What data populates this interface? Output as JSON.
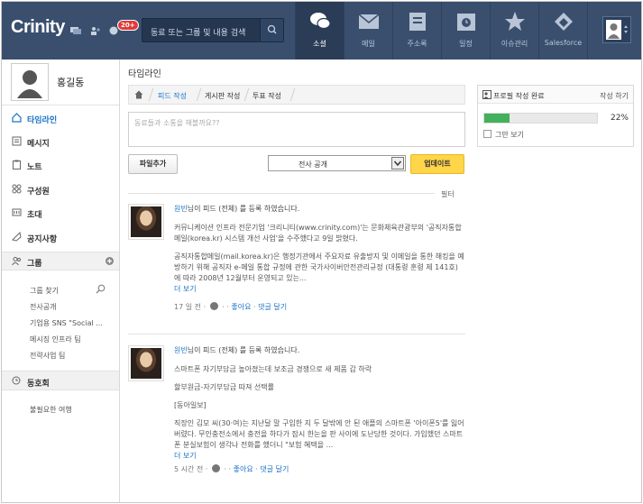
{
  "app": {
    "logo": "Crinity",
    "notification_badge": "20+"
  },
  "search": {
    "placeholder": "동료 또는 그룹 및 내용 검색"
  },
  "nav": [
    {
      "label": "소셜",
      "icon": "chat-bubbles-icon",
      "active": true
    },
    {
      "label": "메일",
      "icon": "mail-icon",
      "active": false
    },
    {
      "label": "주소록",
      "icon": "address-book-icon",
      "active": false
    },
    {
      "label": "일정",
      "icon": "calendar-icon",
      "active": false
    },
    {
      "label": "이슈관리",
      "icon": "star-icon",
      "active": false
    },
    {
      "label": "Salesforce",
      "icon": "salesforce-icon",
      "active": false
    }
  ],
  "profile": {
    "name": "홍길동"
  },
  "sidebar": {
    "items": [
      {
        "label": "타임라인",
        "icon": "home-icon"
      },
      {
        "label": "메시지",
        "icon": "message-icon"
      },
      {
        "label": "노트",
        "icon": "note-icon"
      },
      {
        "label": "구성원",
        "icon": "members-icon"
      },
      {
        "label": "초대",
        "icon": "invite-icon"
      },
      {
        "label": "공지사항",
        "icon": "notice-icon"
      }
    ],
    "group": {
      "label": "그룹",
      "find": "그룹 찾기",
      "subs": [
        "전사공개",
        "기업용 SNS \"Social ...",
        "메시징 인프라 팀",
        "전략사업 팀"
      ]
    },
    "club": {
      "label": "동호회",
      "subs": [
        "불필요한 여행"
      ]
    }
  },
  "main": {
    "title": "타임라인",
    "tabs": [
      "피드 작성",
      "게시판 작성",
      "투표 작성"
    ],
    "compose_placeholder": "동료들과 소통을 해볼까요??",
    "file_button": "파일추가",
    "visibility": "전사 공개",
    "update_button": "업데이트",
    "filter": "필터"
  },
  "posts": [
    {
      "author": "원빈",
      "action": "님이 피드 (전체) 를 등록 하였습니다.",
      "paragraphs": [
        "커뮤니케이션 인프라 전문기업 '크리니티(www.crinity.com)'는 문화체육관광부의 '공직자통합메일(korea.kr) 시스템 개선 사업'을 수주했다고 9일 밝혔다.",
        "공직자통합메일(mail.korea.kr)은 행정기관에서 주요자료 유출방지 및 이메일을 통한 해킹을 예방하기 위해 공직자 e-메일 통합 규정에 관한 국가사이버안전관리규정 (대통령 훈령 제 141호)에 따라 2008년 12월부터 운영되고 있는..."
      ],
      "more": "더 보기",
      "time": "17 일 전",
      "like": "좋아요",
      "comment": "댓글 달기"
    },
    {
      "author": "원빈",
      "action": "님이 피드 (전체) 를 등록 하였습니다.",
      "paragraphs": [
        "스마트폰 자기부담금 높아졌는데 보조금 경쟁으로 새 제품 갑 하락",
        "할부원금-자기부담금 따져 선택률",
        "[동아일보]",
        "직장인 김모 씨(30·여)는 지난달 말 구입한 지 두 달밖에 안 된 애플의 스마트폰 '아이폰5'를 잃어버렸다. 무인충전소에서 충전을 하다가 잠시 한눈을 판 사이에 도난당한 것이다. 가입했던 스마트폰 분실보험이 생각나 전화를 했더니 \"보험 혜택을 ..."
      ],
      "more": "더 보기",
      "time": "5 시간 전",
      "like": "좋아요",
      "comment": "댓글 달기"
    }
  ],
  "profile_panel": {
    "title": "프로필 작성 완료",
    "write": "작성 하기",
    "percent_text": "22%",
    "progress": 0.22,
    "checkbox_label": "그만 보기"
  },
  "colors": {
    "topbar": "#3a4f6e",
    "link": "#1a73c7",
    "update": "#ffd54a",
    "progress": "#43b05c"
  }
}
